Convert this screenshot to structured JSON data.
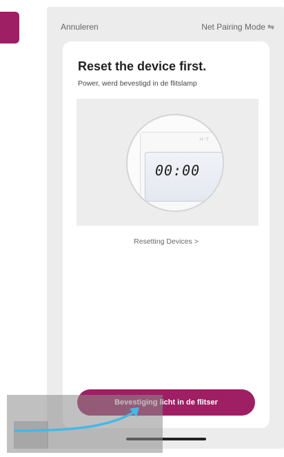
{
  "header": {
    "cancel_label": "Annuleren",
    "mode_label": "Net Pairing Mode",
    "mode_icon": "swap-icon"
  },
  "content": {
    "title": "Reset the device first.",
    "subtitle": "Power, werd bevestigd in de flitslamp",
    "device_model": "H-T",
    "display_value": "00:00",
    "resetting_link": "Resetting Devices >",
    "confirm_button": "Bevestiging licht in de flitser"
  },
  "colors": {
    "brand": "#9e1f63",
    "overlay_arrow": "#45b8e6"
  }
}
